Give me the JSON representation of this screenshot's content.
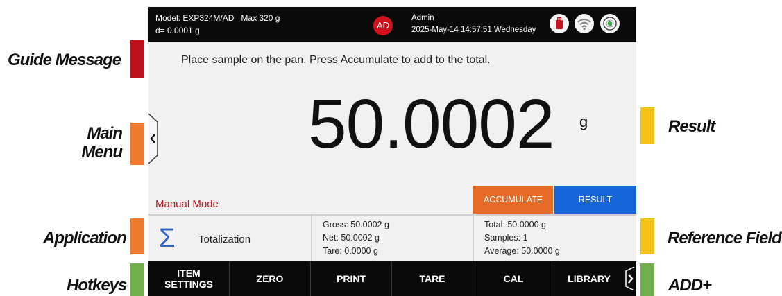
{
  "callouts": {
    "guide_message": "Guide Message",
    "main_menu": "Main\nMenu",
    "application": "Application",
    "hotkeys": "Hotkeys",
    "result": "Result",
    "reference_field": "Reference Field",
    "add_plus": "ADD+"
  },
  "callout_colors": {
    "red": "#c0121b",
    "orange": "#ee7a2e",
    "yellow": "#f4c117",
    "green": "#6fb04a"
  },
  "status_bar": {
    "model": "Model: EXP324M/AD",
    "max": "Max 320 g",
    "readability": "d= 0.0001 g",
    "user_initials": "AD",
    "user_name": "Admin",
    "datetime": "2025-May-14 14:57:51 Wednesday",
    "icons": [
      "usb-icon",
      "wifi-icon",
      "level-icon"
    ]
  },
  "guide_message": "Place sample on the pan. Press Accumulate to add to the total.",
  "result": {
    "value": "50.0002",
    "unit": "g"
  },
  "mode": "Manual Mode",
  "buttons": {
    "accumulate": "ACCUMULATE",
    "result": "RESULT"
  },
  "application": {
    "icon": "sigma-icon",
    "name": "Totalization"
  },
  "reference": {
    "gross": "Gross: 50.0002 g",
    "net": "Net: 50.0002 g",
    "tare": "Tare: 0.0000 g",
    "total": "Total: 50.0000 g",
    "samples": "Samples: 1",
    "average": "Average: 50.0000 g"
  },
  "hotkeys": [
    "ITEM\nSETTINGS",
    "ZERO",
    "PRINT",
    "TARE",
    "CAL",
    "LIBRARY"
  ],
  "colors": {
    "accumulate": "#e76a27",
    "result": "#1666d9",
    "mode_text": "#c4161c",
    "user_badge": "#d1121c"
  }
}
